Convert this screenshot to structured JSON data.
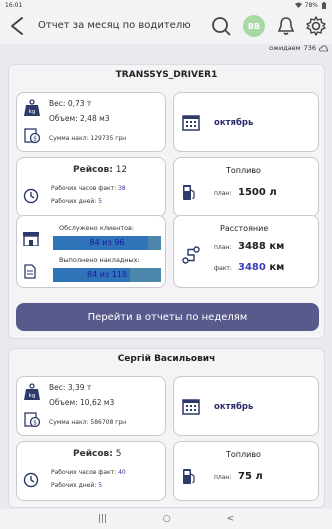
{
  "status": {
    "time": "16:01",
    "battery": "78%"
  },
  "appbar": {
    "title": "Отчет за месяц по водителю",
    "avatar_initials": "ВВ"
  },
  "waiting": {
    "label": "ожидаем",
    "count": "736"
  },
  "drivers": [
    {
      "name": "TRANSSYS_DRIVER1",
      "weight_label": "Вес:",
      "weight_value": "0,73 т",
      "volume_label": "Объем:",
      "volume_value": "2,48 м3",
      "sum_label": "Сумма накл:",
      "sum_value": "129735 грн",
      "month": "октябрь",
      "trips_label": "Рейсов:",
      "trips_value": "12",
      "work_hours_label": "Рабочих часов факт:",
      "work_hours_value": "38",
      "work_days_label": "Рабочих дней:",
      "work_days_value": "5",
      "fuel_title": "Топливо",
      "fuel_plan_label": "план:",
      "fuel_plan_value": "1500",
      "fuel_unit": "л",
      "clients_label": "Обслужено клиентов:",
      "clients_done": "84",
      "clients_total": "96",
      "clients_sep": "из",
      "invoices_label": "Выполнено накладных:",
      "invoices_done": "84",
      "invoices_total": "118",
      "invoices_sep": "из",
      "distance_title": "Расстояние",
      "dist_plan_label": "план:",
      "dist_plan_value": "3488",
      "dist_fact_label": "факт:",
      "dist_fact_value": "3480",
      "dist_unit": "км",
      "button_label": "Перейти в отчеты по неделям"
    },
    {
      "name": "Сергій Васильович",
      "weight_label": "Вес:",
      "weight_value": "3,39 т",
      "volume_label": "Объем:",
      "volume_value": "10,62 м3",
      "sum_label": "Сумма накл:",
      "sum_value": "586708 грн",
      "month": "октябрь",
      "trips_label": "Рейсов:",
      "trips_value": "5",
      "work_hours_label": "Рабочих часов факт:",
      "work_hours_value": "40",
      "work_days_label": "Рабочих дней:",
      "work_days_value": "5",
      "fuel_title": "Топливо",
      "fuel_plan_label": "план:",
      "fuel_plan_value": "75",
      "fuel_unit": "л"
    }
  ],
  "colors": {
    "primary_button": "#595a8c",
    "accent": "#3d3dbb",
    "bar": "#4c86aa"
  },
  "navbar": [
    "|||",
    "○",
    "<"
  ]
}
